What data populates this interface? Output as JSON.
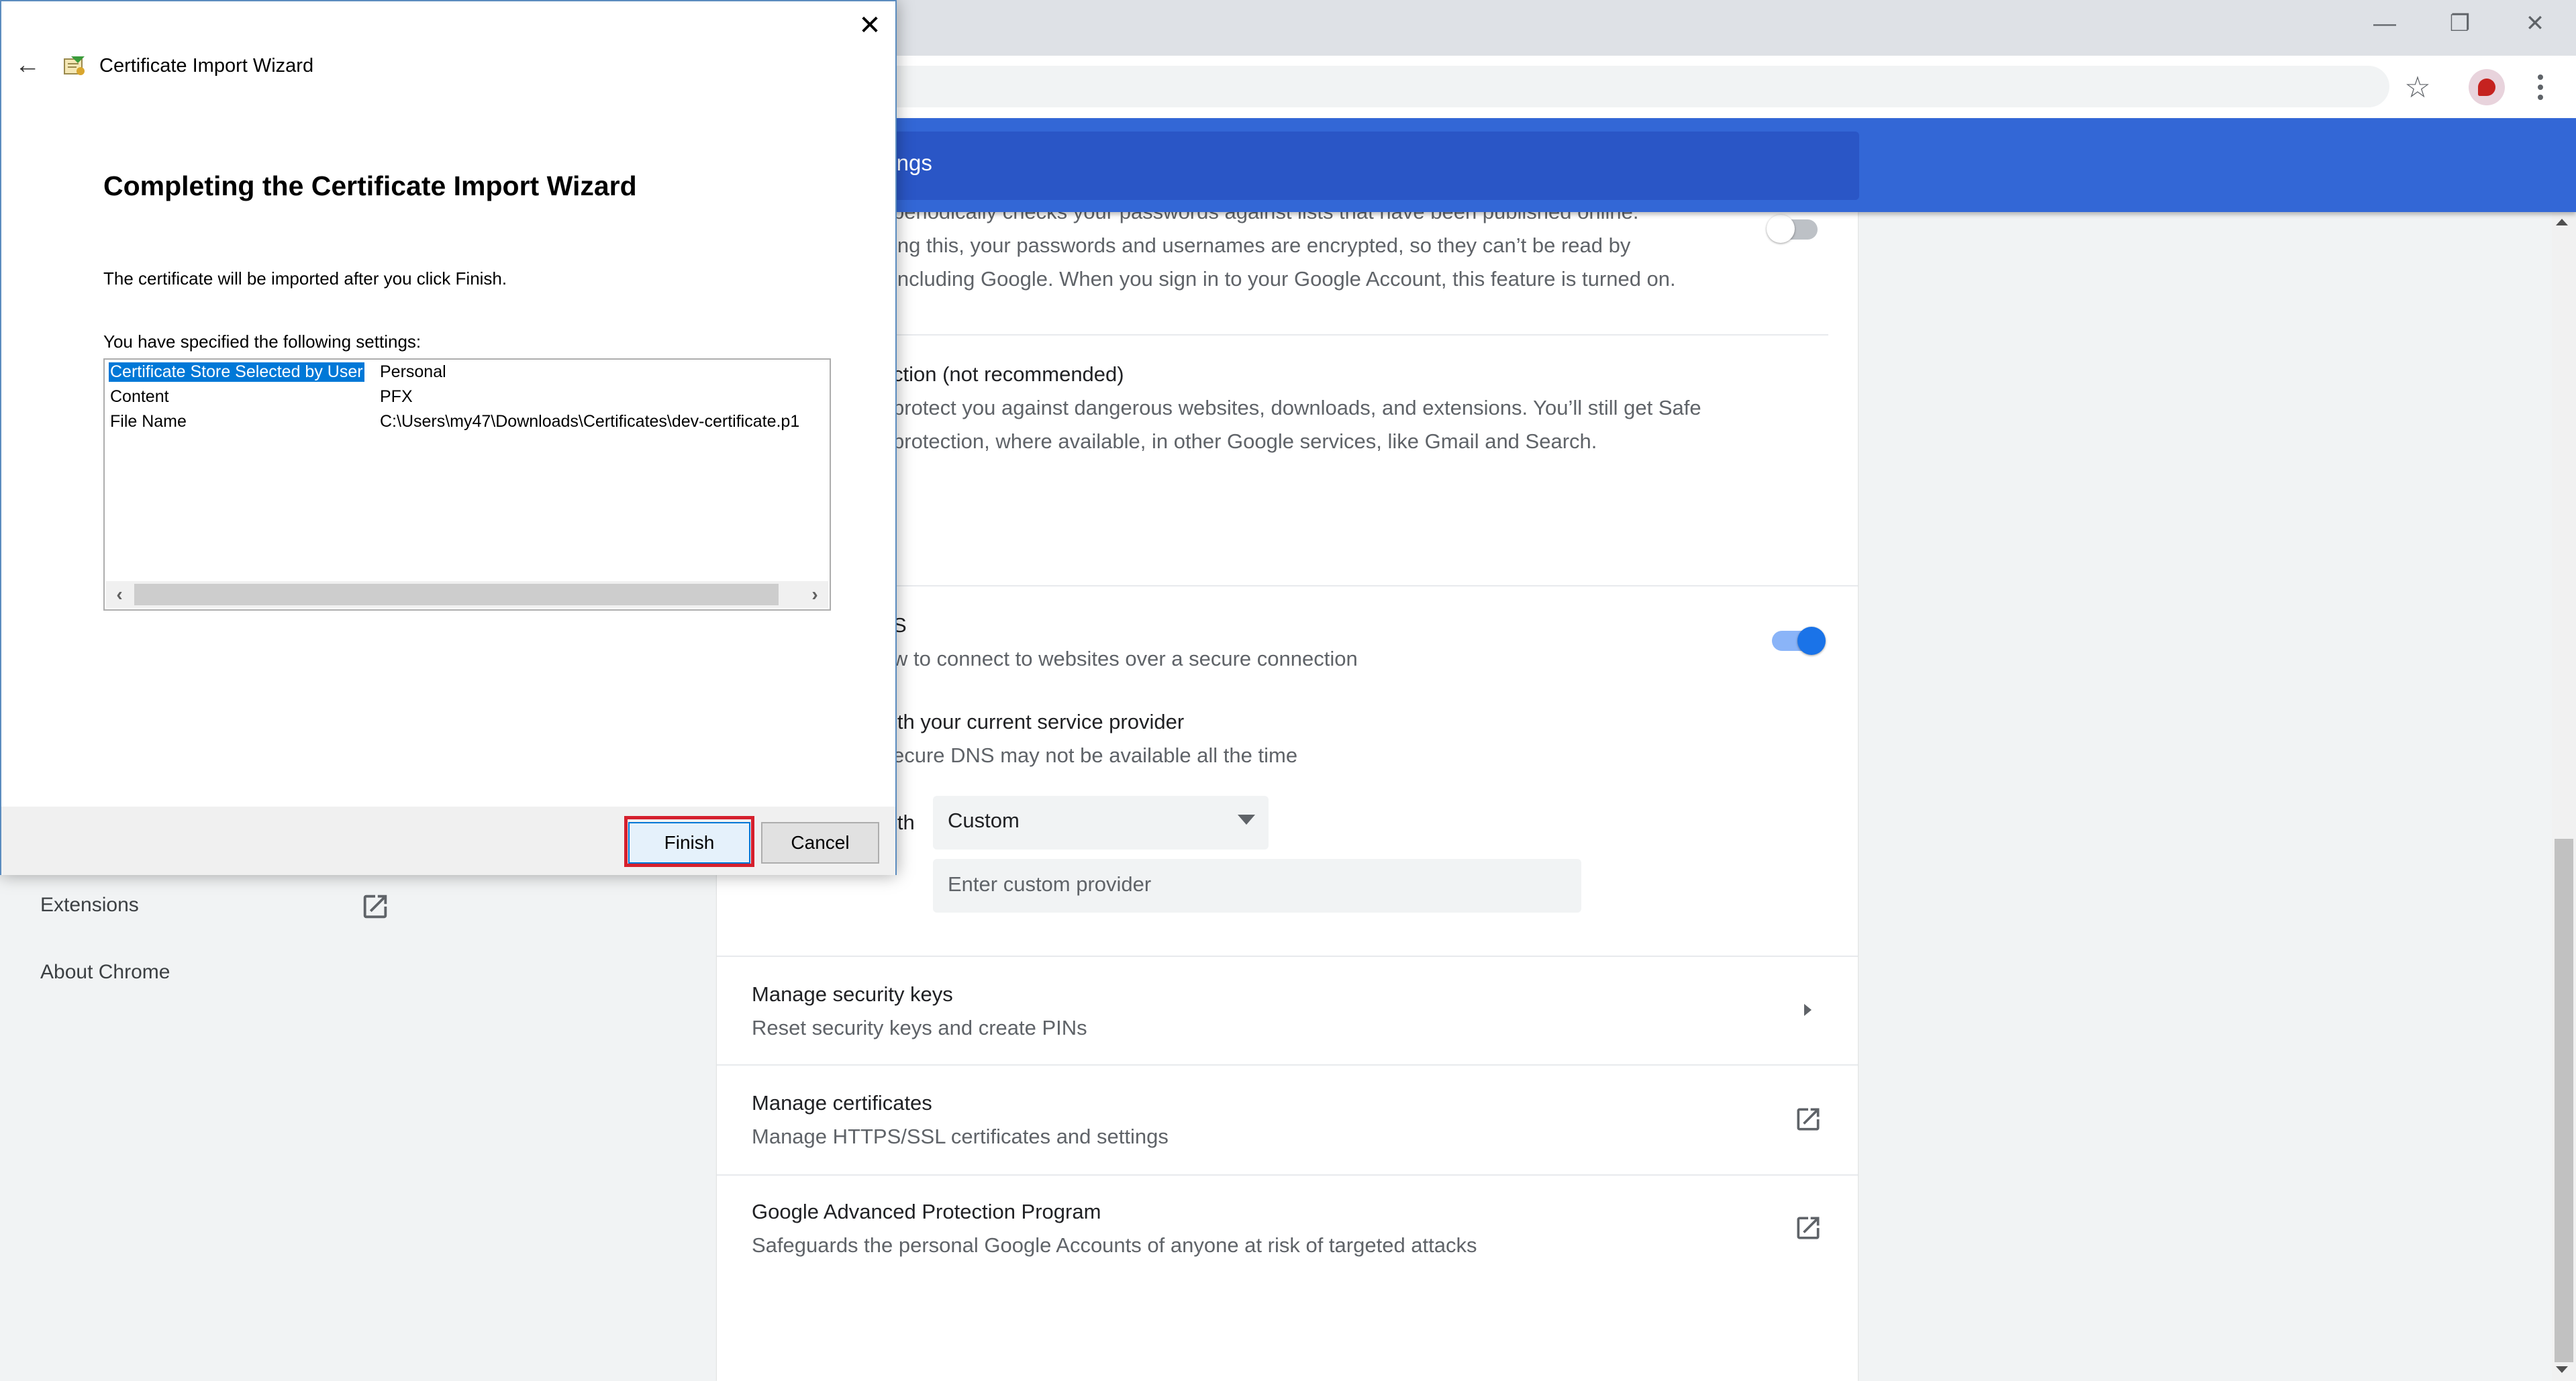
{
  "browser": {
    "window_controls": {
      "minimize": "—",
      "restore": "❐",
      "close": "✕"
    },
    "bookmark_icon": "star-icon",
    "menu_icon": "kebab-menu-icon"
  },
  "settings": {
    "search_partial": "ttings",
    "left_nav": {
      "extensions": "Extensions",
      "about": "About Chrome"
    },
    "password_check": {
      "line1": "periodically checks your passwords against lists that have been published online.",
      "line2": "ing this, your passwords and usernames are encrypted, so they can’t be read by",
      "line3": "including Google. When you sign in to your Google Account, this feature is turned on."
    },
    "no_protection": {
      "title": "ction (not recommended)",
      "line1": "protect you against dangerous websites, downloads, and extensions. You’ll still get Safe",
      "line2": "protection, where available, in other Google services, like Gmail and Search."
    },
    "secure_dns": {
      "title": "S",
      "desc": "w to connect to websites over a secure connection",
      "option_title": "ith your current service provider",
      "option_desc": "ecure DNS may not be available all the time",
      "with_label": "ith",
      "select_value": "Custom",
      "provider_placeholder": "Enter custom provider"
    },
    "security_keys": {
      "title": "Manage security keys",
      "desc": "Reset security keys and create PINs"
    },
    "certificates": {
      "title": "Manage certificates",
      "desc": "Manage HTTPS/SSL certificates and settings"
    },
    "advanced_protection": {
      "title": "Google Advanced Protection Program",
      "desc": "Safeguards the personal Google Accounts of anyone at risk of targeted attacks"
    }
  },
  "wizard": {
    "window_title": "Certificate Import Wizard",
    "close_glyph": "✕",
    "back_glyph": "←",
    "heading": "Completing the Certificate Import Wizard",
    "intro": "The certificate will be imported after you click Finish.",
    "settings_label": "You have specified the following settings:",
    "rows": [
      {
        "key": "Certificate Store Selected by User",
        "value": "Personal"
      },
      {
        "key": "Content",
        "value": "PFX"
      },
      {
        "key": "File Name",
        "value": "C:\\Users\\my47\\Downloads\\Certificates\\dev-certificate.p1"
      }
    ],
    "scroll_left": "‹",
    "scroll_right": "›",
    "finish_label": "Finish",
    "cancel_label": "Cancel",
    "highlight_color": "#d5202d"
  }
}
